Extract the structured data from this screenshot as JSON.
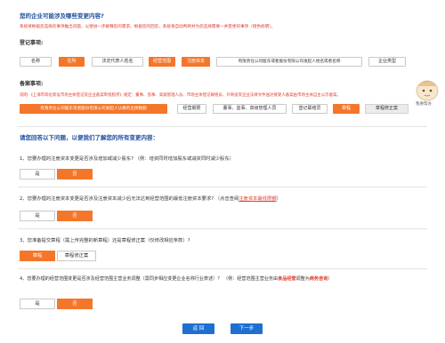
{
  "top": {
    "title": "您的企业可能涉及哪些变更内容?",
    "notice": "系统将根据您选择的事项推出问题，以便进一步解释您的需求。根据您的回答，系统将自动判断并为您选择需要一并变更的事项（橙色标明）。",
    "register_label": "登记事项:",
    "register_items": [
      {
        "label": "名称",
        "state": "normal"
      },
      {
        "label": "住所",
        "state": "on"
      },
      {
        "label": "法定代表人姓名",
        "state": "normal"
      },
      {
        "label": "经营范围",
        "state": "on"
      },
      {
        "label": "注册资本",
        "state": "on"
      },
      {
        "label": "有限责任公司股东或者股份有限公司发起人姓名或者名称",
        "state": "normal"
      },
      {
        "label": "企业类型",
        "state": "normal"
      }
    ],
    "filing_label": "备案事项:",
    "filing_notice": "说明:《上海市简化新设市场主体登记及企业备案审批程序》规定：董事、监事、高级管理人员、市场主体登记联络员、外商投资企业法律文件送达接受人备案由市场主体自主公示备案。",
    "filing_items": [
      {
        "label": "有限责任公司股东或者股份有限公司发起人认缴的出资数额",
        "state": "on"
      },
      {
        "label": "经营期限",
        "state": "normal"
      },
      {
        "label": "董事、监事、高级管理人员",
        "state": "normal"
      },
      {
        "label": "登记联络员",
        "state": "normal"
      },
      {
        "label": "章程",
        "state": "on"
      },
      {
        "label": "章程修正案",
        "state": "gray"
      }
    ]
  },
  "mascot_label": "我要帮办",
  "questions_title": "请您回答以下问题，以便我们了解您的所有变更内容：",
  "questions": [
    {
      "text": "1、您要办理的注册资本变更是否涉及增加或减少股东? （例：增资同时增加股东或减资同时减少股东）",
      "options": [
        {
          "label": "是",
          "state": "normal"
        },
        {
          "label": "否",
          "state": "on"
        }
      ]
    },
    {
      "text": "2、您要办理的注册资本变更是否涉及注册资本减少后无法达到经营范围的最低注册资本要求? （点击查阅",
      "link": "注册资本最低限额",
      "text_after": "）",
      "options": [
        {
          "label": "是",
          "state": "normal"
        },
        {
          "label": "否",
          "state": "on"
        }
      ]
    },
    {
      "text": "3、您准备提交章程（需上传完整的新章程）还是章程修正案（仅修改相应条款）?",
      "options": [
        {
          "label": "章程",
          "state": "on"
        },
        {
          "label": "章程修正案",
          "state": "normal"
        }
      ]
    },
    {
      "text": "4、您要办理的经营范围变更是否涉及经营范围主营业务调整（需同步相应变更企业名称行业表述）？ （例：经营范围主营业务由",
      "link": "食品经营",
      "text_mid": "调整为",
      "link2": "商务咨询",
      "text_after": "）",
      "options": [
        {
          "label": "是",
          "state": "normal"
        },
        {
          "label": "否",
          "state": "on"
        }
      ]
    }
  ],
  "nav": {
    "back": "返 回",
    "next": "下一步"
  },
  "colors": {
    "accent": "#f4762a",
    "title_blue": "#1e4f9e",
    "red": "#e03a2b",
    "button_blue": "#1f6fd1"
  }
}
